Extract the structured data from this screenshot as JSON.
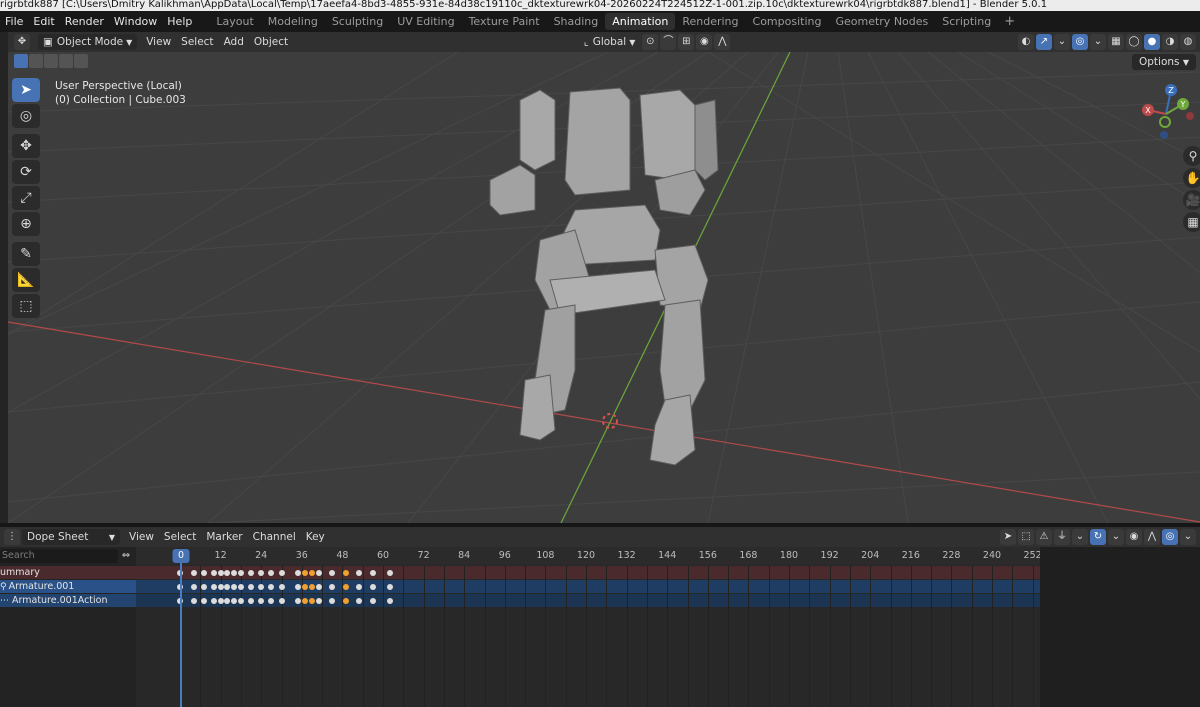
{
  "window": {
    "title": "rigrbtdk887 [C:\\Users\\Dmitry Kalikhman\\AppData\\Local\\Temp\\17aeefa4-8bd3-4855-931e-84d38c19110c_dktexturewrk04-20260224T224512Z-1-001.zip.10c\\dktexturewrk04\\rigrbtdk887.blend1] - Blender 5.0.1"
  },
  "menubar": {
    "menus": [
      "File",
      "Edit",
      "Render",
      "Window",
      "Help"
    ],
    "workspaces": [
      "Layout",
      "Modeling",
      "Sculpting",
      "UV Editing",
      "Texture Paint",
      "Shading",
      "Animation",
      "Rendering",
      "Compositing",
      "Geometry Nodes",
      "Scripting"
    ],
    "active_workspace": "Animation",
    "add_tab": "+"
  },
  "viewport_header": {
    "mode": "Object Mode",
    "menus": [
      "View",
      "Select",
      "Add",
      "Object"
    ],
    "orientation": "Global",
    "options": "Options"
  },
  "viewport": {
    "perspective_label": "User Perspective (Local)",
    "collection_label": "(0) Collection | Cube.003",
    "gizmo_axes": {
      "z": "Z",
      "y": "Y",
      "x": "X"
    },
    "colors": {
      "background": "#3d3d3d",
      "x_axis": "#b34a4a",
      "y_axis": "#6ea83a",
      "active_tool": "#4772b3"
    }
  },
  "dope_sheet": {
    "editor_type": "Dope Sheet",
    "menus": [
      "View",
      "Select",
      "Marker",
      "Channel",
      "Key"
    ],
    "search_placeholder": "Search",
    "current_frame": "0",
    "frame_labels": [
      "12",
      "24",
      "36",
      "48",
      "60",
      "72",
      "84",
      "96",
      "108",
      "120",
      "132",
      "144",
      "156",
      "168",
      "180",
      "192",
      "204",
      "216",
      "228",
      "240",
      "252"
    ],
    "channels": [
      {
        "label": "ummary"
      },
      {
        "label": "Armature.001"
      },
      {
        "label": "Armature.001Action"
      }
    ],
    "keyframes": [
      0,
      4,
      7,
      10,
      12,
      14,
      16,
      18,
      21,
      24,
      27,
      30,
      35,
      37,
      39,
      41,
      45,
      49,
      53,
      57,
      62
    ],
    "selected_keyframes": [
      37,
      39,
      49
    ]
  }
}
